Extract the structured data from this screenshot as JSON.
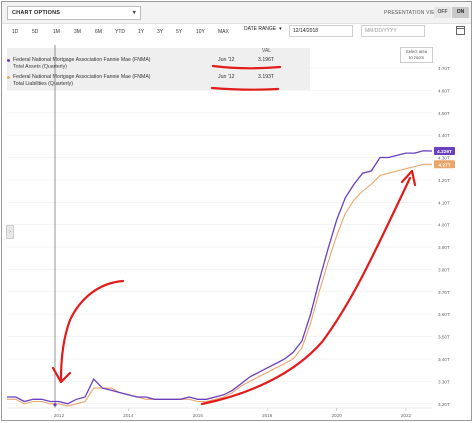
{
  "toolbar": {
    "chart_options_label": "CHART OPTIONS",
    "presentation_view_label": "PRESENTATION VIEW",
    "off_label": "OFF",
    "on_label": "ON"
  },
  "ranges": [
    "1D",
    "5D",
    "1M",
    "3M",
    "6M",
    "YTD",
    "1Y",
    "3Y",
    "5Y",
    "10Y",
    "MAX"
  ],
  "date_range": {
    "label": "DATE RANGE",
    "from_value": "12/14/2018",
    "to_placeholder": "MM/DD/YYYY"
  },
  "legend": {
    "val_header": "VAL",
    "select_area": [
      "Select area",
      "to zoom"
    ],
    "rows": [
      {
        "name_line1": "Federal National Mortgage Association Fannie Mae (FNMA)",
        "name_line2": "Total Assets (Quarterly)",
        "date": "Jun '12",
        "value": "3.196T",
        "color": "#6a3fc0"
      },
      {
        "name_line1": "Federal National Mortgage Association Fannie Mae (FNMA)",
        "name_line2": "Total Liabilities (Quarterly)",
        "date": "Jun '12",
        "value": "3.193T",
        "color": "#e9a66a"
      }
    ]
  },
  "chart_data": {
    "type": "line",
    "x_tick_labels": [
      "2012",
      "2014",
      "2016",
      "2018",
      "2020",
      "2022"
    ],
    "y_tick_labels": [
      "4.70T",
      "4.60T",
      "4.50T",
      "4.40T",
      "4.30T",
      "4.20T",
      "4.10T",
      "4.00T",
      "3.90T",
      "3.80T",
      "3.70T",
      "3.60T",
      "3.50T",
      "3.40T",
      "3.30T",
      "3.20T"
    ],
    "ylim": [
      3.19,
      4.7
    ],
    "series": [
      {
        "name": "Total Assets (Quarterly)",
        "color": "#6a3fc0",
        "end_label": "4.329T",
        "x": [
          2010.75,
          2011.0,
          2011.25,
          2011.5,
          2011.75,
          2012.0,
          2012.25,
          2012.5,
          2012.75,
          2013.0,
          2013.25,
          2013.5,
          2013.75,
          2014.0,
          2014.25,
          2014.5,
          2014.75,
          2015.0,
          2015.25,
          2015.5,
          2015.75,
          2016.0,
          2016.25,
          2016.5,
          2016.75,
          2017.0,
          2017.25,
          2017.5,
          2017.75,
          2018.0,
          2018.25,
          2018.5,
          2018.75,
          2019.0,
          2019.25,
          2019.5,
          2019.75,
          2020.0,
          2020.25,
          2020.5,
          2020.75,
          2021.0,
          2021.25,
          2021.5,
          2021.75,
          2022.0,
          2022.25,
          2022.5,
          2022.75,
          2023.0
        ],
        "y": [
          3.23,
          3.23,
          3.21,
          3.22,
          3.22,
          3.21,
          3.21,
          3.2,
          3.22,
          3.23,
          3.31,
          3.27,
          3.26,
          3.25,
          3.24,
          3.23,
          3.23,
          3.22,
          3.22,
          3.22,
          3.22,
          3.23,
          3.22,
          3.22,
          3.23,
          3.24,
          3.26,
          3.29,
          3.32,
          3.34,
          3.36,
          3.38,
          3.4,
          3.43,
          3.48,
          3.6,
          3.75,
          3.89,
          4.02,
          4.12,
          4.18,
          4.23,
          4.24,
          4.3,
          4.3,
          4.31,
          4.32,
          4.32,
          4.33,
          4.329
        ]
      },
      {
        "name": "Total Liabilities (Quarterly)",
        "color": "#e9a66a",
        "end_label": "4.27T",
        "x": [
          2010.75,
          2011.0,
          2011.25,
          2011.5,
          2011.75,
          2012.0,
          2012.25,
          2012.5,
          2012.75,
          2013.0,
          2013.25,
          2013.5,
          2013.75,
          2014.0,
          2014.25,
          2014.5,
          2014.75,
          2015.0,
          2015.25,
          2015.5,
          2015.75,
          2016.0,
          2016.25,
          2016.5,
          2016.75,
          2017.0,
          2017.25,
          2017.5,
          2017.75,
          2018.0,
          2018.25,
          2018.5,
          2018.75,
          2019.0,
          2019.25,
          2019.5,
          2019.75,
          2020.0,
          2020.25,
          2020.5,
          2020.75,
          2021.0,
          2021.25,
          2021.5,
          2021.75,
          2022.0,
          2022.25,
          2022.5,
          2022.75,
          2023.0
        ],
        "y": [
          3.22,
          3.22,
          3.2,
          3.21,
          3.21,
          3.2,
          3.2,
          3.19,
          3.2,
          3.21,
          3.27,
          3.27,
          3.27,
          3.25,
          3.24,
          3.23,
          3.22,
          3.22,
          3.22,
          3.22,
          3.22,
          3.22,
          3.21,
          3.21,
          3.22,
          3.23,
          3.25,
          3.28,
          3.3,
          3.32,
          3.34,
          3.36,
          3.38,
          3.4,
          3.45,
          3.56,
          3.7,
          3.83,
          3.95,
          4.05,
          4.11,
          4.15,
          4.18,
          4.22,
          4.23,
          4.24,
          4.25,
          4.26,
          4.27,
          4.27
        ]
      }
    ]
  }
}
